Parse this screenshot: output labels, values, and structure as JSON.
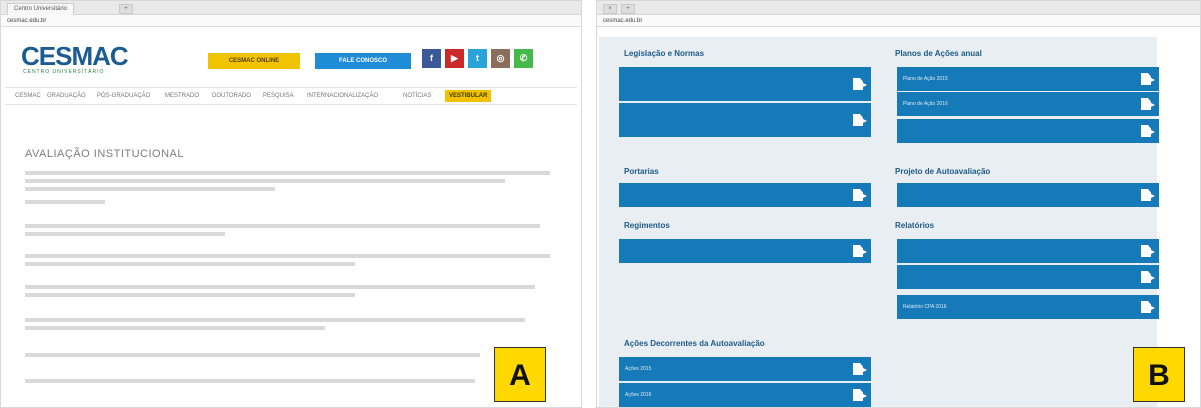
{
  "panel_a": {
    "browser_tab": "Centro Universitário",
    "url_prefix": "cesmac.edu.br",
    "logo": "CESMAC",
    "logo_sub": "CENTRO UNIVERSITÁRIO",
    "header_buttons": [
      "CESMAC ONLINE",
      "FALE CONOSCO"
    ],
    "social_icons": [
      "facebook-icon",
      "youtube-icon",
      "twitter-icon",
      "instagram-icon",
      "whatsapp-icon"
    ],
    "menu": [
      "CESMAC",
      "GRADUAÇÃO",
      "PÓS-GRADUAÇÃO",
      "MESTRADO",
      "DOUTORADO",
      "PESQUISA",
      "INTERNACIONALIZAÇÃO",
      "NOTÍCIAS",
      "VESTIBULAR"
    ],
    "page_title": "AVALIAÇÃO INSTITUCIONAL",
    "corner_label": "A"
  },
  "panel_b": {
    "url_prefix": "cesmac.edu.br",
    "sections": {
      "legislacao": {
        "title": "Legislação e Normas",
        "items": [
          "",
          ""
        ]
      },
      "planos": {
        "title": "Planos de Ações anual",
        "items": [
          "Plano de Ação 2015",
          "Plano de Ação 2016",
          ""
        ]
      },
      "portarias": {
        "title": "Portarias",
        "items": [
          ""
        ]
      },
      "projeto": {
        "title": "Projeto de Autoavaliação",
        "items": [
          ""
        ]
      },
      "regimentos": {
        "title": "Regimentos",
        "items": [
          ""
        ]
      },
      "relatorios": {
        "title": "Relatórios",
        "items": [
          "",
          "",
          "Relatório CPA 2016"
        ]
      },
      "acoes": {
        "title": "Ações Decorrentes da Autoavaliação",
        "items": [
          "Ações 2015",
          "Ações 2016"
        ]
      }
    },
    "corner_label": "B"
  },
  "colors": {
    "cesmac_blue": "#1b5c92",
    "button_blue": "#167ab9",
    "label_yellow": "#ffd800"
  }
}
